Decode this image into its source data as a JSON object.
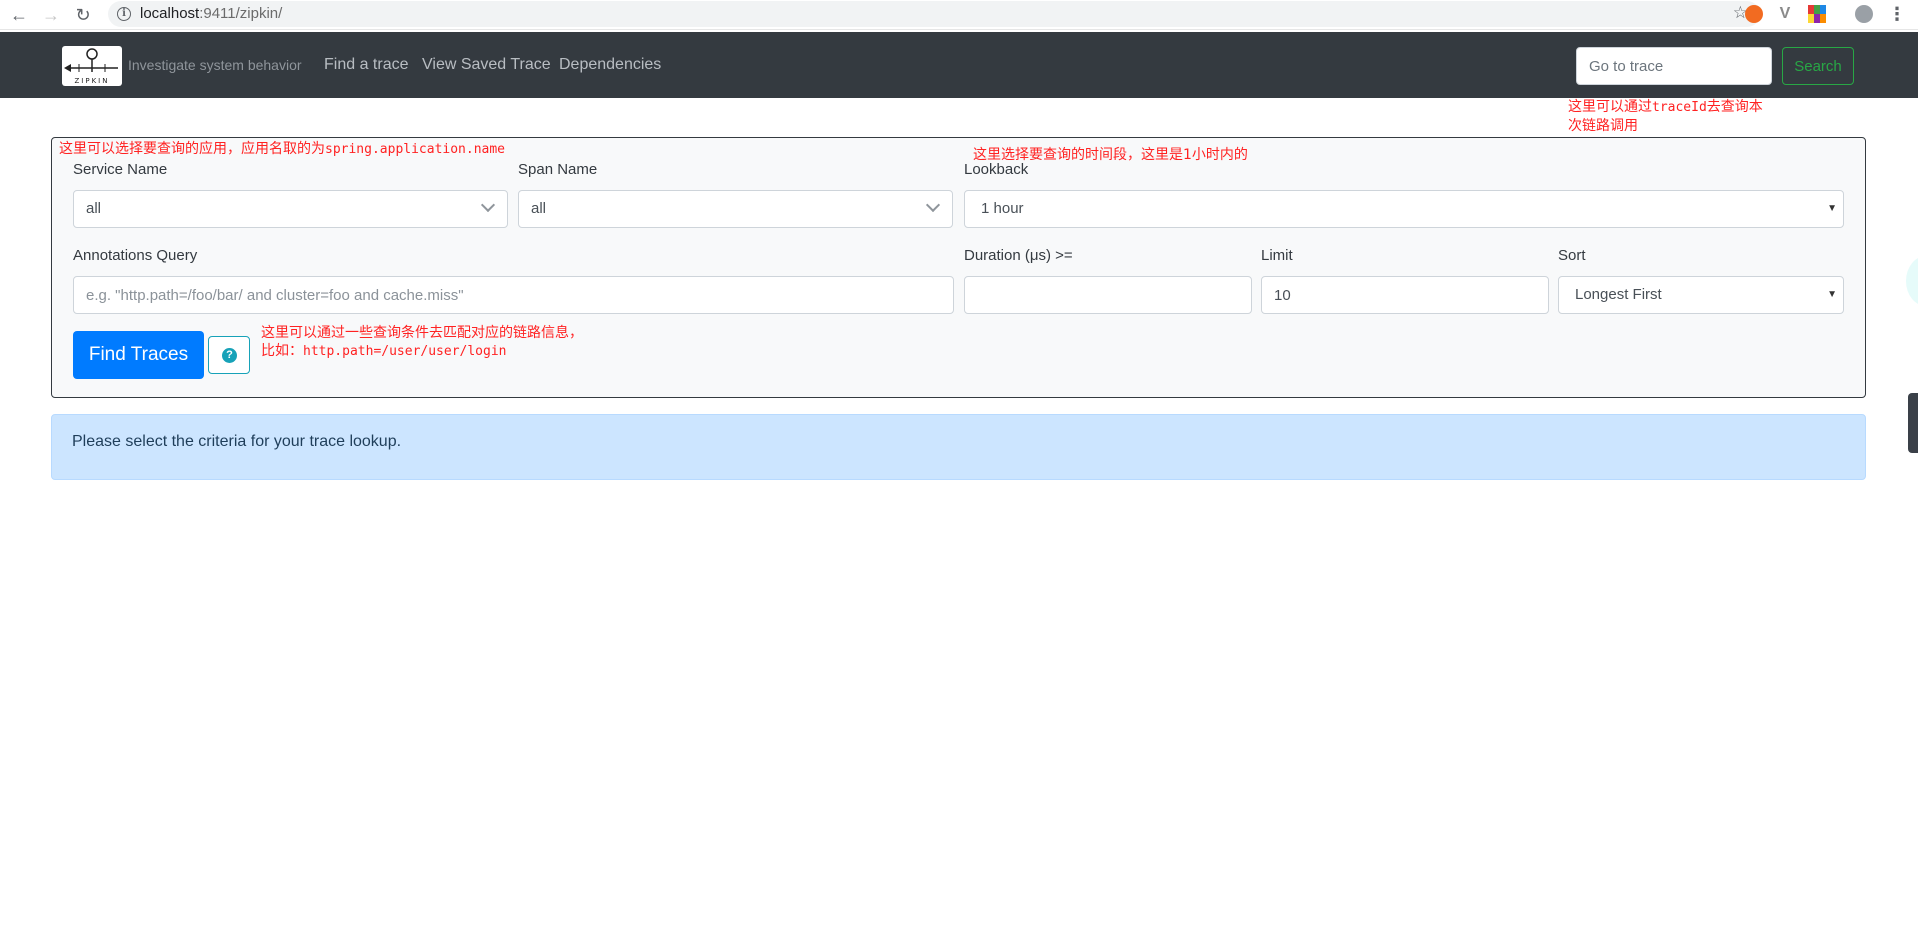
{
  "browser": {
    "url_host": "localhost",
    "url_rest": ":9411/zipkin/"
  },
  "navbar": {
    "logo_text": "ZIPKIN",
    "tagline": "Investigate system behavior",
    "links": [
      "Find a trace",
      "View Saved Trace",
      "Dependencies"
    ],
    "goto_placeholder": "Go to trace",
    "search_label": "Search"
  },
  "annotations": {
    "traceid_line1_a": "这里可以通过",
    "traceid_line1_code": "traceId",
    "traceid_line1_b": "去查询本",
    "traceid_line2": "次链路调用",
    "service_a": "这里可以选择要查询的应用，应用名取的为",
    "service_code": "spring.application.name",
    "lookback": "这里选择要查询的时间段，这里是1小时内的",
    "query_line1": "这里可以通过一些查询条件去匹配对应的链路信息，",
    "query_line2_a": "比如：",
    "query_line2_code": "http.path=/user/user/login"
  },
  "form": {
    "service_label": "Service Name",
    "service_value": "all",
    "span_label": "Span Name",
    "span_value": "all",
    "lookback_label": "Lookback",
    "lookback_value": "1 hour",
    "annotations_label": "Annotations Query",
    "annotations_placeholder": "e.g. \"http.path=/foo/bar/ and cluster=foo and cache.miss\"",
    "duration_label": "Duration (μs) >=",
    "duration_value": "",
    "limit_label": "Limit",
    "limit_value": "10",
    "sort_label": "Sort",
    "sort_value": "Longest First",
    "find_label": "Find Traces",
    "help_glyph": "?"
  },
  "alert": {
    "message": "Please select the criteria for your trace lookup."
  },
  "colors": {
    "navbar_bg": "#343a40",
    "primary": "#007bff",
    "success": "#28a745",
    "info": "#17a2b8",
    "alert_bg": "#cce5ff",
    "annotation_red": "#ff2222"
  }
}
